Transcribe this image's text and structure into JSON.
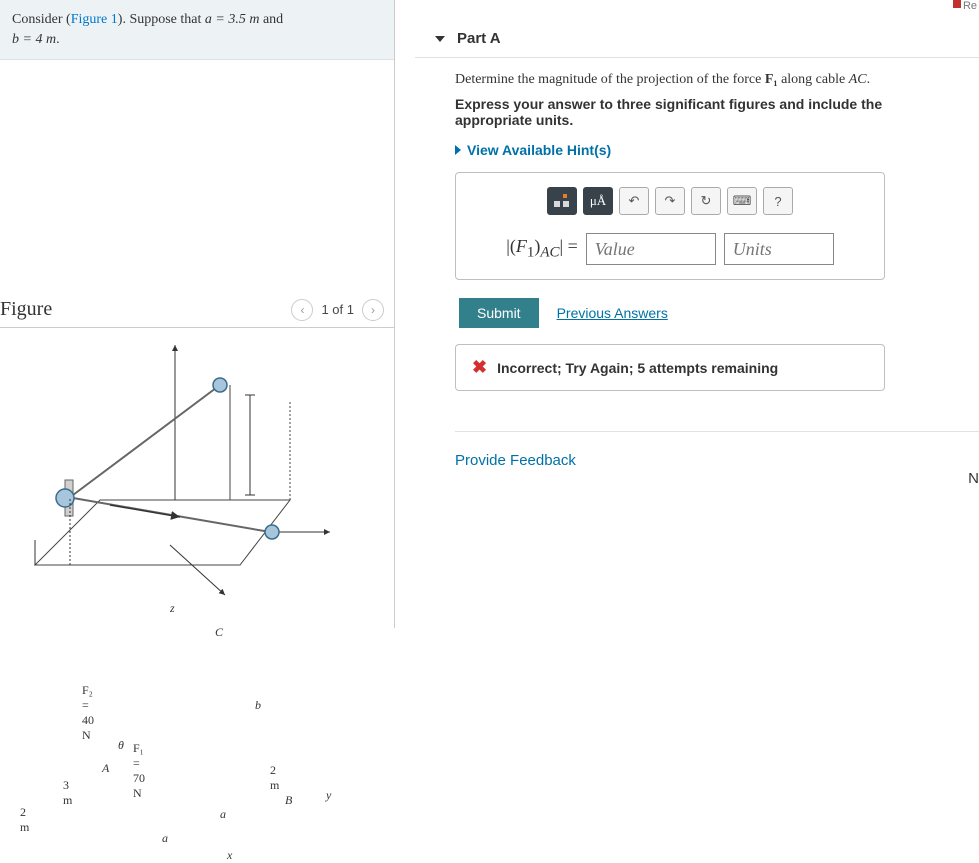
{
  "top_fragment": "Re",
  "prompt": {
    "pre": "Consider (",
    "figlink": "Figure 1",
    "post": "). Suppose that ",
    "a_expr": "a = 3.5 m",
    "and": " and ",
    "b_expr": "b = 4 m",
    "end": "."
  },
  "figure_header": {
    "title": "Figure",
    "counter": "1 of 1"
  },
  "diagram": {
    "F2": "F₂ = 40 N",
    "F1": "F₁ = 70 N",
    "theta": "θ",
    "z": "z",
    "C": "C",
    "b": "b",
    "A": "A",
    "B": "B",
    "y": "y",
    "x": "x",
    "a1": "a",
    "a2": "a",
    "d2m_left": "2 m",
    "d3m": "3 m",
    "d2m_right": "2 m"
  },
  "part": {
    "header": "Part A",
    "question_pre": "Determine the magnitude of the projection of the force ",
    "question_force": "F₁",
    "question_mid": " along cable ",
    "question_cable": "AC",
    "question_end": ".",
    "instruction": "Express your answer to three significant figures and include the appropriate units.",
    "hints": "View Available Hint(s)"
  },
  "toolbar": {
    "sigma": "μÅ",
    "undo": "↶",
    "redo": "↷",
    "reset": "↻",
    "keyboard": "⌨",
    "help": "?"
  },
  "answer": {
    "label_html": "|(F₁)",
    "label_sub": "AC",
    "label_end": "| =",
    "value_ph": "Value",
    "units_ph": "Units"
  },
  "actions": {
    "submit": "Submit",
    "previous": "Previous Answers"
  },
  "feedback": {
    "text": "Incorrect; Try Again; 5 attempts remaining"
  },
  "footer": {
    "provide": "Provide Feedback",
    "next_frag": "N"
  }
}
